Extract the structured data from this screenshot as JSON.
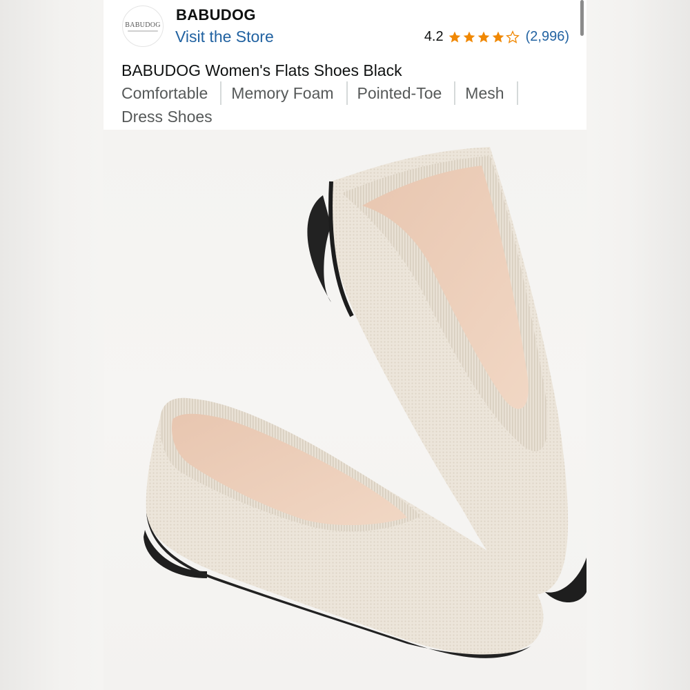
{
  "store": {
    "brand_name": "BABUDOG",
    "logo_text": "BABUDOG",
    "visit_link": "Visit the Store"
  },
  "rating": {
    "value": "4.2",
    "stars": 4.2,
    "star_color": "#f08804",
    "review_count": "(2,996)"
  },
  "product": {
    "title": "BABUDOG Women's Flats Shoes Black",
    "features": [
      "Comfortable",
      "Memory Foam",
      "Pointed-Toe",
      "Mesh",
      "Dress Shoes"
    ]
  },
  "colors": {
    "link": "#2162a1",
    "text": "#0f1111",
    "muted_text": "#565959"
  }
}
